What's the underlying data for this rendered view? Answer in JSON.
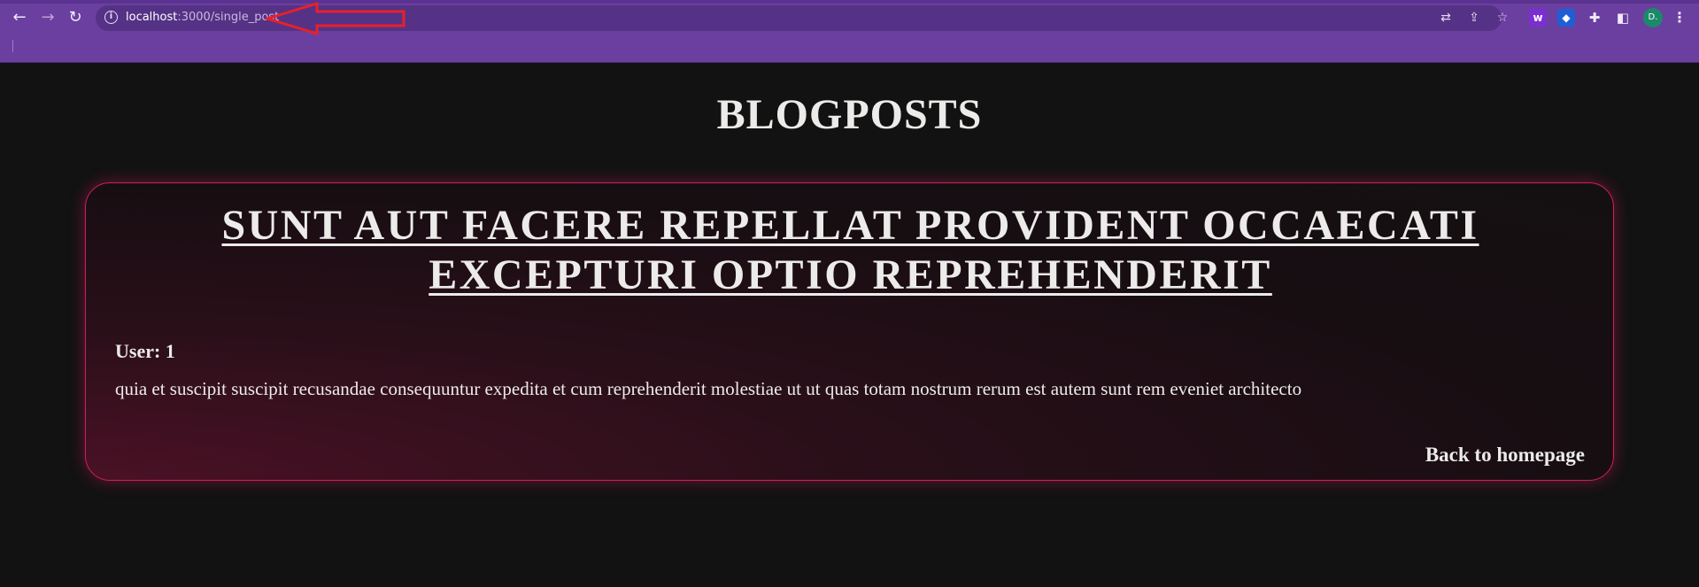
{
  "browser": {
    "url_host": "localhost",
    "url_path": ":3000/single_post",
    "avatar_initial": "D.",
    "extension_letter": "w"
  },
  "page": {
    "heading": "BLOGPOSTS"
  },
  "post": {
    "title": "SUNT AUT FACERE REPELLAT PROVIDENT OCCAECATI EXCEPTURI OPTIO REPREHENDERIT",
    "user_label": "User: 1",
    "body": "quia et suscipit suscipit recusandae consequuntur expedita et cum reprehenderit molestiae ut ut quas totam nostrum rerum est autem sunt rem eveniet architecto",
    "back_label": "Back to homepage"
  },
  "colors": {
    "chrome": "#6a3fa0",
    "omnibox": "#553285",
    "page_bg": "#121212",
    "card_border": "#d21d60",
    "text": "#ecebe9",
    "annotation_arrow": "#e8202a"
  },
  "icons": [
    "back-arrow-icon",
    "forward-arrow-icon",
    "reload-icon",
    "info-icon",
    "translate-icon",
    "share-icon",
    "star-icon",
    "extension-w-icon",
    "shield-extension-icon",
    "puzzle-extensions-icon",
    "side-panel-icon",
    "kebab-menu-icon"
  ]
}
